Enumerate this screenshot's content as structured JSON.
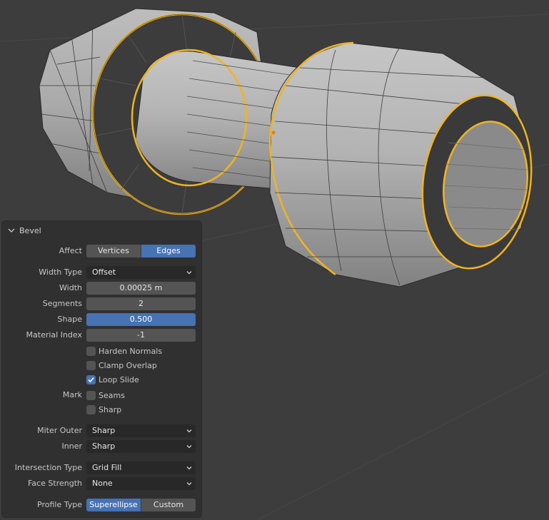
{
  "panel": {
    "title": "Bevel",
    "affect": {
      "label": "Affect",
      "options": [
        "Vertices",
        "Edges"
      ],
      "selected": "Edges"
    },
    "width_type": {
      "label": "Width Type",
      "value": "Offset"
    },
    "width": {
      "label": "Width",
      "value": "0.00025 m"
    },
    "segments": {
      "label": "Segments",
      "value": "2"
    },
    "shape": {
      "label": "Shape",
      "value": "0.500",
      "fraction": 0.5
    },
    "material_index": {
      "label": "Material Index",
      "value": "-1"
    },
    "harden_normals": {
      "label": "Harden Normals",
      "checked": false
    },
    "clamp_overlap": {
      "label": "Clamp Overlap",
      "checked": false
    },
    "loop_slide": {
      "label": "Loop Slide",
      "checked": true
    },
    "mark": {
      "label": "Mark",
      "seams": {
        "label": "Seams",
        "checked": false
      },
      "sharp": {
        "label": "Sharp",
        "checked": false
      }
    },
    "miter_outer": {
      "label": "Miter Outer",
      "value": "Sharp"
    },
    "miter_inner": {
      "label": "Inner",
      "value": "Sharp"
    },
    "intersection_type": {
      "label": "Intersection Type",
      "value": "Grid Fill"
    },
    "face_strength": {
      "label": "Face Strength",
      "value": "None"
    },
    "profile_type": {
      "label": "Profile Type",
      "options": [
        "Superellipse",
        "Custom"
      ],
      "selected": "Superellipse"
    }
  },
  "colors": {
    "accent": "#4772b3",
    "selection": "#f0b323",
    "background": "#3d3d3d",
    "panel": "#303030"
  },
  "icons": [
    "chevron-down-icon",
    "checkmark-icon",
    "dropdown-arrow-icon"
  ]
}
